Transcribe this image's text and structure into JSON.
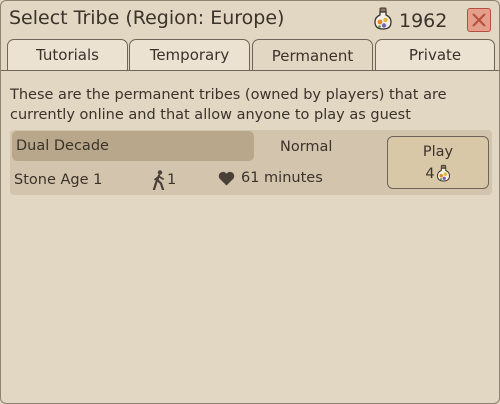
{
  "dialog": {
    "title": "Select Tribe (Region: Europe)",
    "currency_amount": "1962",
    "currency_icon": "potion-bottle-icon",
    "close_icon": "close-icon"
  },
  "tabs": [
    {
      "label": "Tutorials",
      "active": false
    },
    {
      "label": "Temporary",
      "active": false
    },
    {
      "label": "Permanent",
      "active": true
    },
    {
      "label": "Private",
      "active": false
    }
  ],
  "description": "These are the permanent tribes (owned by players) that are currently online and that allow anyone to play as guest",
  "tribes": [
    {
      "name": "Dual Decade",
      "mode": "Normal",
      "era": "Stone Age 1",
      "players": "1",
      "player_icon": "walking-person-icon",
      "time": "61 minutes",
      "time_icon": "heart-icon",
      "play_label": "Play",
      "play_cost": "4",
      "cost_icon": "potion-bottle-icon"
    }
  ],
  "colors": {
    "background": "#e2d7c2",
    "panel": "#d3c5ad",
    "highlight": "#b8a78a",
    "close_button": "#e39f8b",
    "text": "#3b332b"
  }
}
